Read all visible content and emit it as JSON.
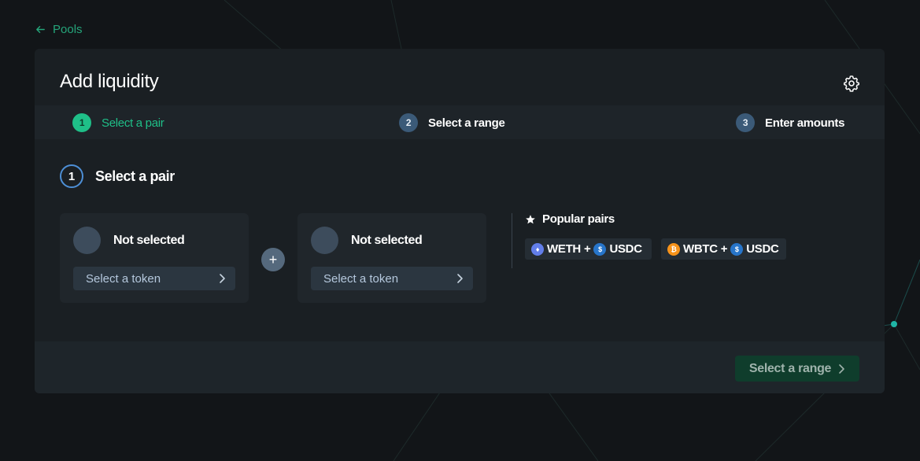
{
  "nav": {
    "back_label": "Pools"
  },
  "card": {
    "title": "Add liquidity",
    "steps": [
      {
        "number": "1",
        "label": "Select a pair",
        "state": "active"
      },
      {
        "number": "2",
        "label": "Select a range",
        "state": "inactive"
      },
      {
        "number": "3",
        "label": "Enter amounts",
        "state": "inactive"
      }
    ],
    "section": {
      "number": "1",
      "label": "Select a pair"
    },
    "token_a": {
      "status": "Not selected",
      "button_label": "Select a token"
    },
    "token_b": {
      "status": "Not selected",
      "button_label": "Select a token"
    },
    "plus_symbol": "+",
    "popular": {
      "title": "Popular pairs",
      "pairs": [
        {
          "base": "WETH",
          "plus": "+",
          "quote": "USDC",
          "base_icon": "eth-icon",
          "quote_icon": "usdc-icon"
        },
        {
          "base": "WBTC",
          "plus": "+",
          "quote": "USDC",
          "base_icon": "btc-icon",
          "quote_icon": "usdc-icon"
        }
      ]
    },
    "footer": {
      "next_button_label": "Select a range"
    }
  },
  "colors": {
    "accent": "#1fbf88",
    "step_inactive": "#3b5a78",
    "background": "#121518",
    "card": "#1a1f23"
  }
}
